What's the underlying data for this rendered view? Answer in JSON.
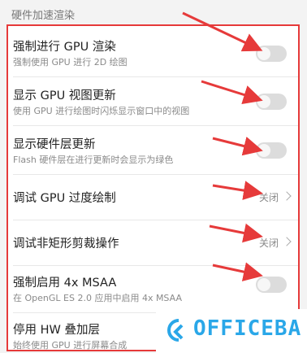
{
  "section": {
    "title": "硬件加速渲染"
  },
  "rows": [
    {
      "title": "强制进行 GPU 渲染",
      "subtitle": "强制使用 GPU 进行 2D 绘图",
      "control": "toggle",
      "on": false
    },
    {
      "title": "显示 GPU 视图更新",
      "subtitle": "使用 GPU 进行绘图时闪烁显示窗口中的视图",
      "control": "toggle",
      "on": false
    },
    {
      "title": "显示硬件层更新",
      "subtitle": "Flash 硬件层在进行更新时会显示为绿色",
      "control": "toggle",
      "on": false
    },
    {
      "title": "调试 GPU 过度绘制",
      "value": "关闭",
      "control": "select"
    },
    {
      "title": "调试非矩形剪裁操作",
      "value": "关闭",
      "control": "select"
    },
    {
      "title": "强制启用 4x MSAA",
      "subtitle": "在 OpenGL ES 2.0 应用中启用 4x MSAA",
      "control": "toggle",
      "on": false
    },
    {
      "title": "停用 HW 叠加层",
      "subtitle": "始终使用 GPU 进行屏幕合成",
      "control": "toggle",
      "on": false
    }
  ],
  "watermark": {
    "text": "OFFICEBA",
    "icon": "cloud-logo-icon"
  },
  "colors": {
    "highlight": "#e63a3a",
    "watermark": "#2aa7e8",
    "toggle_off": "#dcdcdc"
  }
}
